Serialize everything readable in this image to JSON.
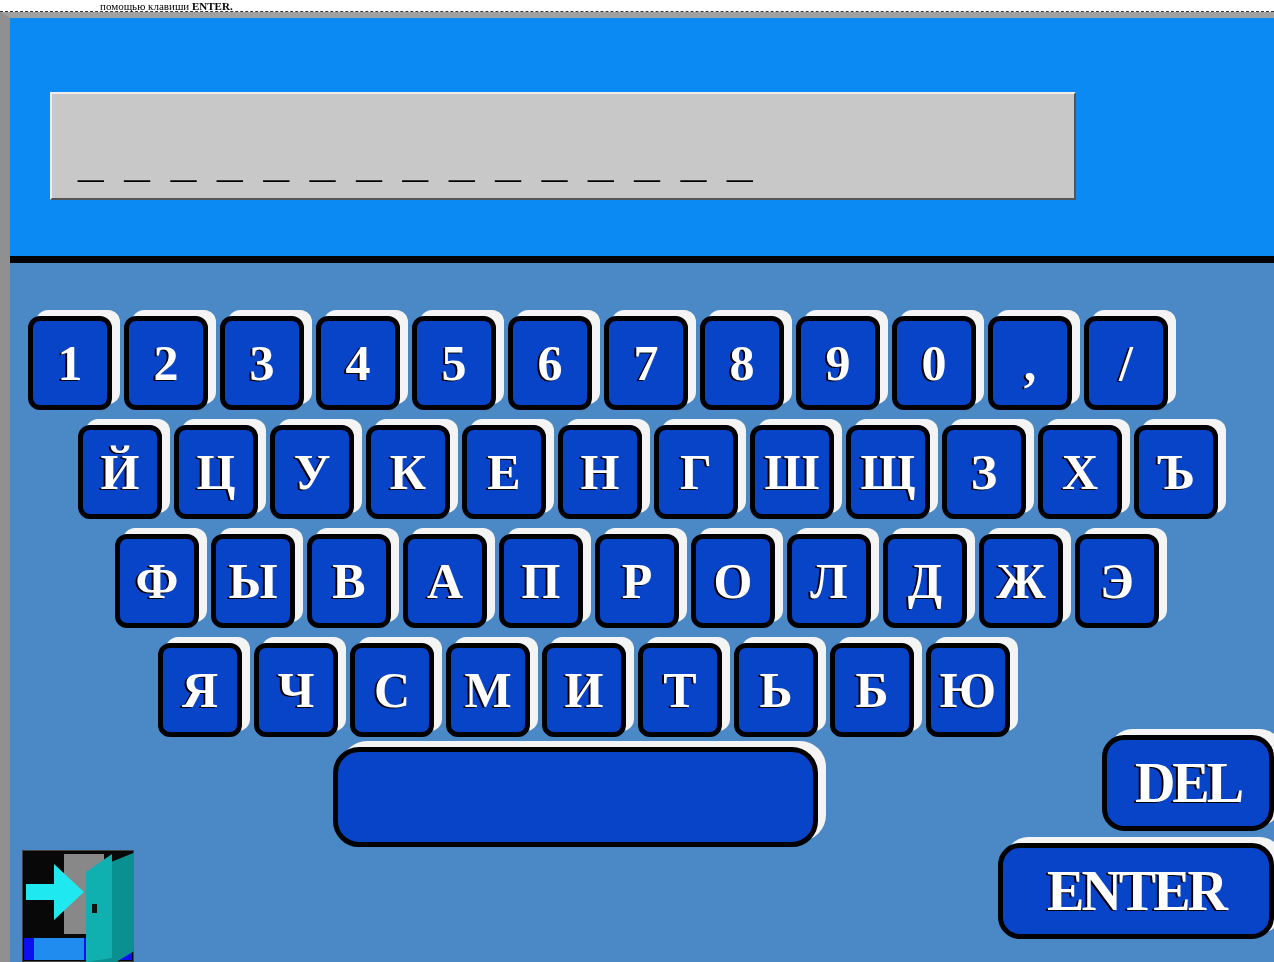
{
  "caption": "помощью клавиши **ENTER.**",
  "display": {
    "value": "_ _ _ _ _ _ _ _ _ _ _ _ _ _ _"
  },
  "key_rows": [
    [
      "1",
      "2",
      "3",
      "4",
      "5",
      "6",
      "7",
      "8",
      "9",
      "0",
      ",",
      "/"
    ],
    [
      "Й",
      "Ц",
      "У",
      "К",
      "Е",
      "Н",
      "Г",
      "Ш",
      "Щ",
      "З",
      "Х",
      "Ъ"
    ],
    [
      "Ф",
      "Ы",
      "В",
      "А",
      "П",
      "Р",
      "О",
      "Л",
      "Д",
      "Ж",
      "Э"
    ],
    [
      "Я",
      "Ч",
      "С",
      "М",
      "И",
      "Т",
      "Ь",
      "Б",
      "Ю"
    ]
  ],
  "del_key": "DEL",
  "enter_key": "ENTER"
}
